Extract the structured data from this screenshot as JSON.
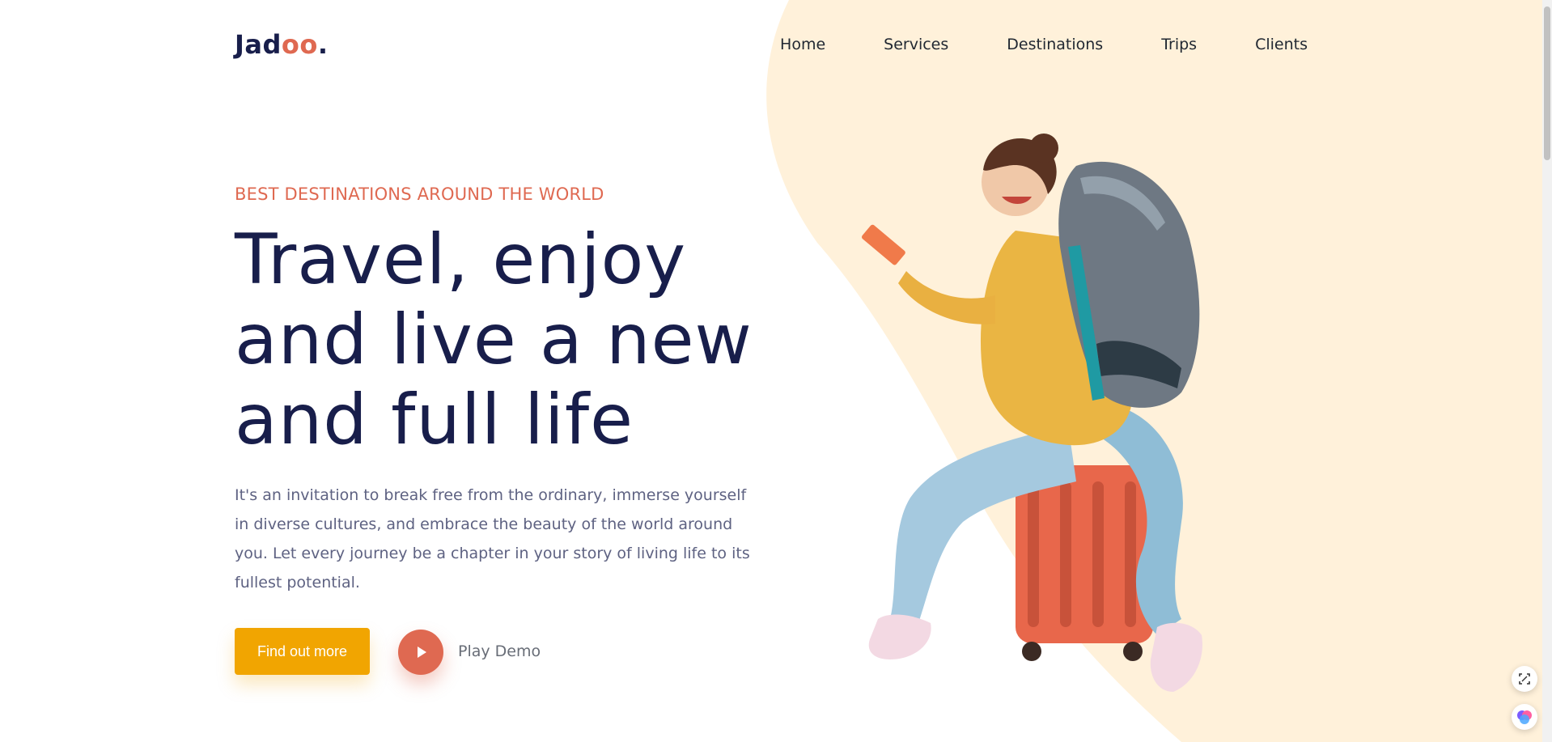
{
  "brand": {
    "logo_start": "Jad",
    "logo_accent": "oo",
    "logo_end": "."
  },
  "nav": {
    "home": "Home",
    "services": "Services",
    "destinations": "Destinations",
    "trips": "Trips",
    "clients": "Clients"
  },
  "hero": {
    "eyebrow": "BEST DESTINATIONS AROUND THE WORLD",
    "headline_line1": "Travel, enjoy",
    "headline_line2": "and live a new",
    "headline_line3": "and full life",
    "lead": "It's an invitation to break free from the ordinary, immerse yourself in diverse cultures, and embrace the beauty of the world around you. Let every journey be a chapter in your story of living life to its fullest potential.",
    "cta_label": "Find out more",
    "play_label": "Play Demo"
  },
  "icons": {
    "play": "play-icon",
    "fab_one": "screenshot-icon",
    "fab_two": "brain-icon"
  },
  "colors": {
    "accent": "#df6951",
    "cta": "#f1a501",
    "blob": "#fff1da",
    "heading": "#181e4b",
    "body": "#5e6282"
  }
}
